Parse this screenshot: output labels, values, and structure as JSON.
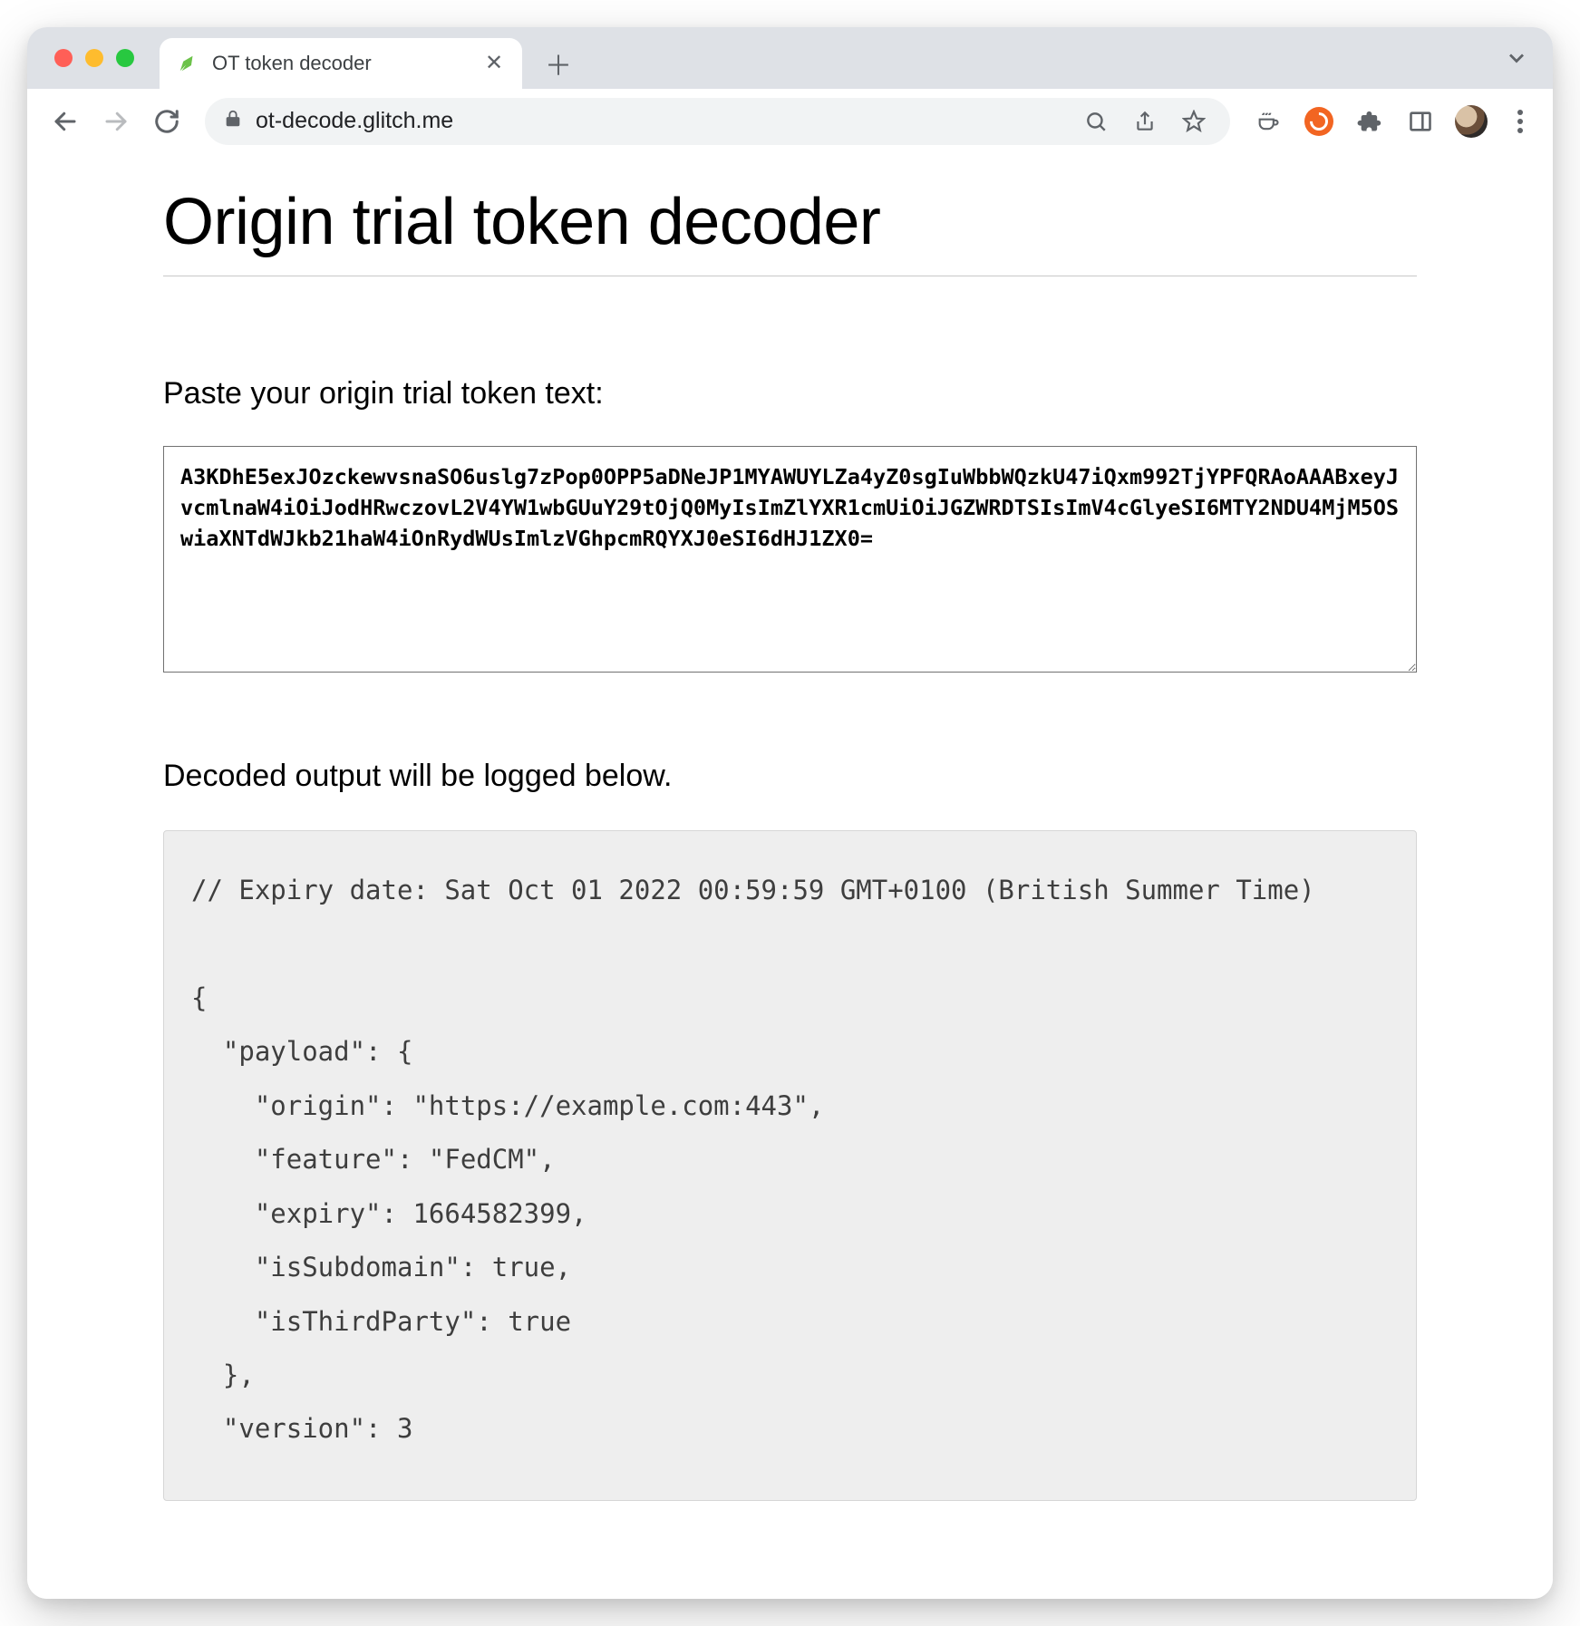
{
  "browser": {
    "tab_title": "OT token decoder",
    "url": "ot-decode.glitch.me"
  },
  "page": {
    "title": "Origin trial token decoder",
    "paste_label": "Paste your origin trial token text:",
    "token_value": "A3KDhE5exJOzckewvsnaSO6uslg7zPop0OPP5aDNeJP1MYAWUYLZa4yZ0sgIuWbbWQzkU47iQxm992TjYPFQRAoAAABxeyJvcmlnaW4iOiJodHRwczovL2V4YW1wbGUuY29tOjQ0MyIsImZlYXR1cmUiOiJGZWRDTSIsImV4cGlyeSI6MTY2NDU4MjM5OSwiaXNTdWJkb21haW4iOnRydWUsImlzVGhpcmRQYXJ0eSI6dHJ1ZX0=",
    "output_label": "Decoded output will be logged below.",
    "output_text": "// Expiry date: Sat Oct 01 2022 00:59:59 GMT+0100 (British Summer Time)\n\n{\n  \"payload\": {\n    \"origin\": \"https://example.com:443\",\n    \"feature\": \"FedCM\",\n    \"expiry\": 1664582399,\n    \"isSubdomain\": true,\n    \"isThirdParty\": true\n  },\n  \"version\": 3"
  },
  "decoded": {
    "expiry_comment": "Expiry date: Sat Oct 01 2022 00:59:59 GMT+0100 (British Summer Time)",
    "payload": {
      "origin": "https://example.com:443",
      "feature": "FedCM",
      "expiry": 1664582399,
      "isSubdomain": true,
      "isThirdParty": true
    },
    "version": 3
  }
}
